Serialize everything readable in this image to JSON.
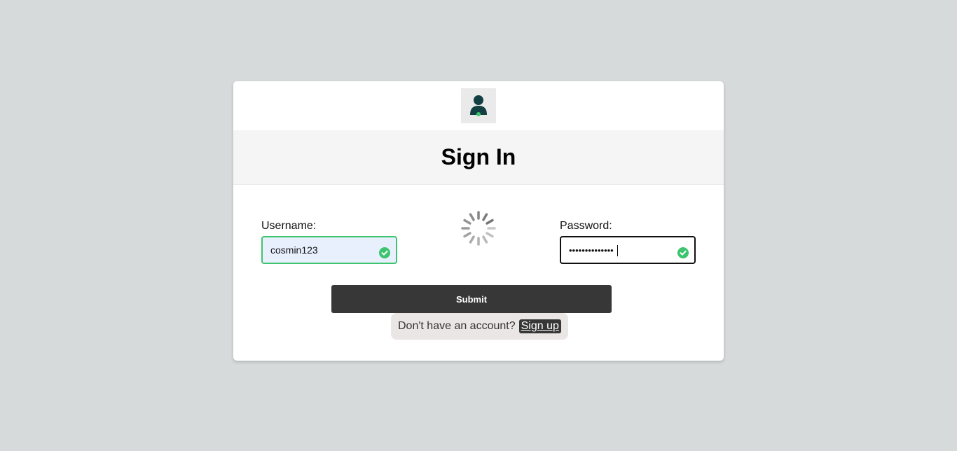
{
  "title": "Sign In",
  "username": {
    "label": "Username:",
    "value": "cosmin123",
    "valid": true
  },
  "password": {
    "label": "Password:",
    "masked_value": "••••••••••••••",
    "valid": true
  },
  "submit_label": "Submit",
  "signup": {
    "prompt": "Don't have an account?",
    "link_label": "Sign up"
  },
  "icons": {
    "logo": "user-avatar-icon",
    "valid": "check-circle-icon",
    "loading": "loading-spinner-icon"
  },
  "colors": {
    "background": "#d6dadb",
    "button": "#373737",
    "valid_green": "#3cc46f",
    "autofill_bg": "#e8f0fe"
  }
}
